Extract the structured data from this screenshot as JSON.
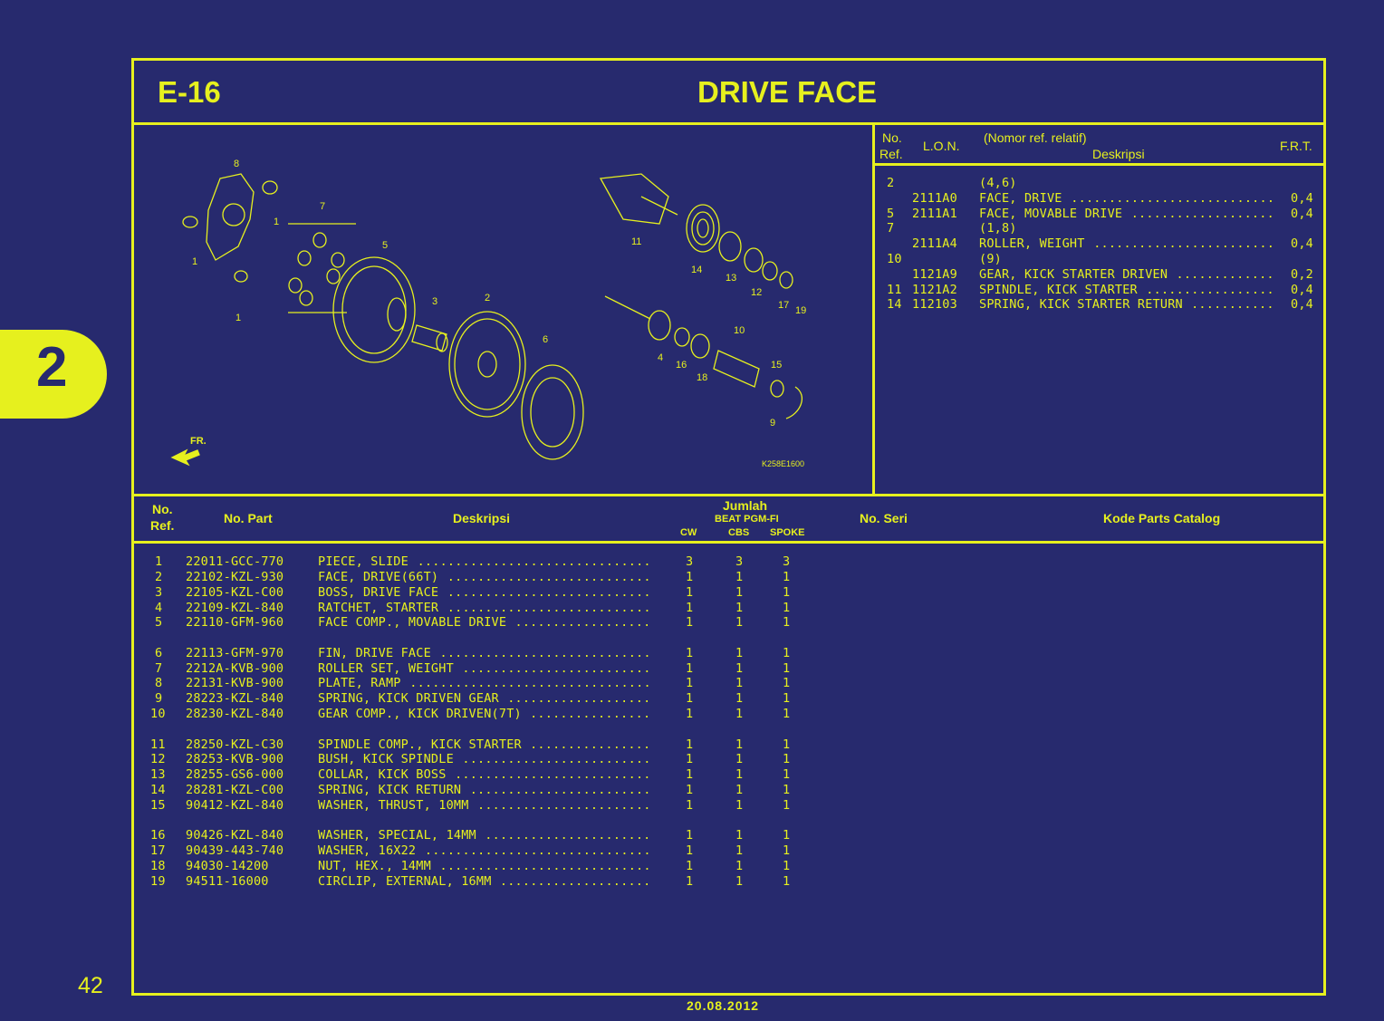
{
  "section_tab": "2",
  "page_number": "42",
  "date": "20.08.2012",
  "header": {
    "code": "E-16",
    "title": "DRIVE FACE"
  },
  "diagram": {
    "ref_code": "K258E1600",
    "direction_label": "FR.",
    "callouts": [
      "8",
      "7",
      "1",
      "1",
      "1",
      "5",
      "3",
      "2",
      "6",
      "11",
      "14",
      "13",
      "12",
      "17",
      "19",
      "10",
      "4",
      "16",
      "18",
      "15",
      "9"
    ]
  },
  "lon_table": {
    "headers": {
      "no": "No.",
      "ref": "Ref.",
      "lon": "L.O.N.",
      "nomor": "(Nomor ref. relatif)",
      "desc": "Deskripsi",
      "frt": "F.R.T."
    },
    "rows": [
      {
        "ref": "2",
        "lon": "",
        "desc": "(4,6)",
        "frt": ""
      },
      {
        "ref": "",
        "lon": "2111A0",
        "desc": "FACE, DRIVE",
        "frt": "0,4"
      },
      {
        "ref": "5",
        "lon": "2111A1",
        "desc": "FACE, MOVABLE DRIVE",
        "frt": "0,4"
      },
      {
        "ref": "7",
        "lon": "",
        "desc": "(1,8)",
        "frt": ""
      },
      {
        "ref": "",
        "lon": "2111A4",
        "desc": "ROLLER, WEIGHT",
        "frt": "0,4"
      },
      {
        "ref": "10",
        "lon": "",
        "desc": "(9)",
        "frt": ""
      },
      {
        "ref": "",
        "lon": "1121A9",
        "desc": "GEAR, KICK STARTER DRIVEN",
        "frt": "0,2"
      },
      {
        "ref": "11",
        "lon": "1121A2",
        "desc": "SPINDLE, KICK STARTER",
        "frt": "0,4"
      },
      {
        "ref": "14",
        "lon": "112103",
        "desc": "SPRING, KICK STARTER RETURN",
        "frt": "0,4"
      }
    ]
  },
  "parts_table": {
    "headers": {
      "no": "No.",
      "ref": "Ref.",
      "part": "No. Part",
      "desc": "Deskripsi",
      "jumlah": "Jumlah",
      "model": "BEAT PGM-FI",
      "cw": "CW",
      "cbs": "CBS",
      "spoke": "SPOKE",
      "seri": "No. Seri",
      "catalog": "Kode Parts Catalog"
    },
    "rows": [
      {
        "ref": "1",
        "part": "22011-GCC-770",
        "desc": "PIECE, SLIDE",
        "cw": "3",
        "cbs": "3",
        "spoke": "3"
      },
      {
        "ref": "2",
        "part": "22102-KZL-930",
        "desc": "FACE, DRIVE(66T)",
        "cw": "1",
        "cbs": "1",
        "spoke": "1"
      },
      {
        "ref": "3",
        "part": "22105-KZL-C00",
        "desc": "BOSS, DRIVE FACE",
        "cw": "1",
        "cbs": "1",
        "spoke": "1"
      },
      {
        "ref": "4",
        "part": "22109-KZL-840",
        "desc": "RATCHET, STARTER",
        "cw": "1",
        "cbs": "1",
        "spoke": "1"
      },
      {
        "ref": "5",
        "part": "22110-GFM-960",
        "desc": "FACE COMP., MOVABLE DRIVE",
        "cw": "1",
        "cbs": "1",
        "spoke": "1"
      },
      {
        "ref": "6",
        "part": "22113-GFM-970",
        "desc": "FIN, DRIVE FACE",
        "cw": "1",
        "cbs": "1",
        "spoke": "1"
      },
      {
        "ref": "7",
        "part": "2212A-KVB-900",
        "desc": "ROLLER SET, WEIGHT",
        "cw": "1",
        "cbs": "1",
        "spoke": "1"
      },
      {
        "ref": "8",
        "part": "22131-KVB-900",
        "desc": "PLATE, RAMP",
        "cw": "1",
        "cbs": "1",
        "spoke": "1"
      },
      {
        "ref": "9",
        "part": "28223-KZL-840",
        "desc": "SPRING, KICK DRIVEN GEAR",
        "cw": "1",
        "cbs": "1",
        "spoke": "1"
      },
      {
        "ref": "10",
        "part": "28230-KZL-840",
        "desc": "GEAR COMP., KICK DRIVEN(7T)",
        "cw": "1",
        "cbs": "1",
        "spoke": "1"
      },
      {
        "ref": "11",
        "part": "28250-KZL-C30",
        "desc": "SPINDLE COMP., KICK STARTER",
        "cw": "1",
        "cbs": "1",
        "spoke": "1"
      },
      {
        "ref": "12",
        "part": "28253-KVB-900",
        "desc": "BUSH, KICK SPINDLE",
        "cw": "1",
        "cbs": "1",
        "spoke": "1"
      },
      {
        "ref": "13",
        "part": "28255-GS6-000",
        "desc": "COLLAR, KICK BOSS",
        "cw": "1",
        "cbs": "1",
        "spoke": "1"
      },
      {
        "ref": "14",
        "part": "28281-KZL-C00",
        "desc": "SPRING, KICK RETURN",
        "cw": "1",
        "cbs": "1",
        "spoke": "1"
      },
      {
        "ref": "15",
        "part": "90412-KZL-840",
        "desc": "WASHER, THRUST, 10MM",
        "cw": "1",
        "cbs": "1",
        "spoke": "1"
      },
      {
        "ref": "16",
        "part": "90426-KZL-840",
        "desc": "WASHER, SPECIAL, 14MM",
        "cw": "1",
        "cbs": "1",
        "spoke": "1"
      },
      {
        "ref": "17",
        "part": "90439-443-740",
        "desc": "WASHER, 16X22",
        "cw": "1",
        "cbs": "1",
        "spoke": "1"
      },
      {
        "ref": "18",
        "part": "94030-14200",
        "desc": "NUT, HEX., 14MM",
        "cw": "1",
        "cbs": "1",
        "spoke": "1"
      },
      {
        "ref": "19",
        "part": "94511-16000",
        "desc": "CIRCLIP, EXTERNAL, 16MM",
        "cw": "1",
        "cbs": "1",
        "spoke": "1"
      }
    ]
  }
}
